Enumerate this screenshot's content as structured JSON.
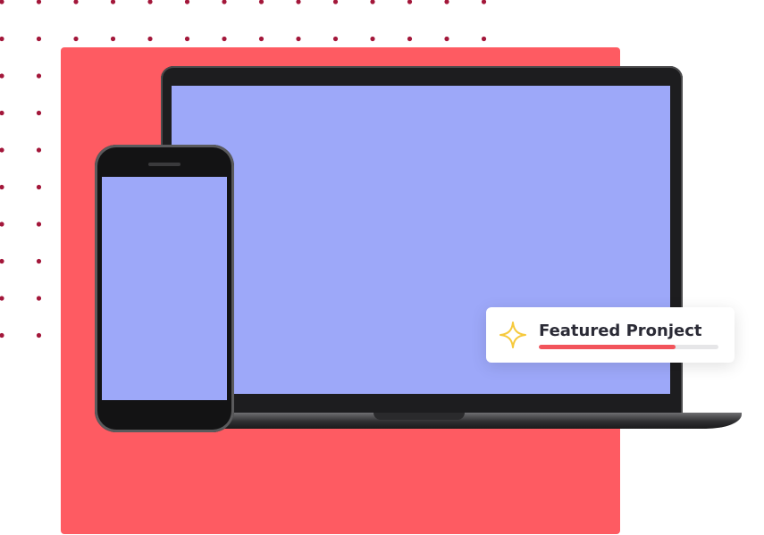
{
  "colors": {
    "backdrop": "#fe5b62",
    "screen": "#9da8f9",
    "dots": "#a3173a",
    "device_frame": "#1d1d1f",
    "accent": "#f2545b",
    "star": "#f6c93c"
  },
  "featured_card": {
    "icon": "sparkle-icon",
    "title": "Featured Pronject",
    "progress": 0.76
  }
}
